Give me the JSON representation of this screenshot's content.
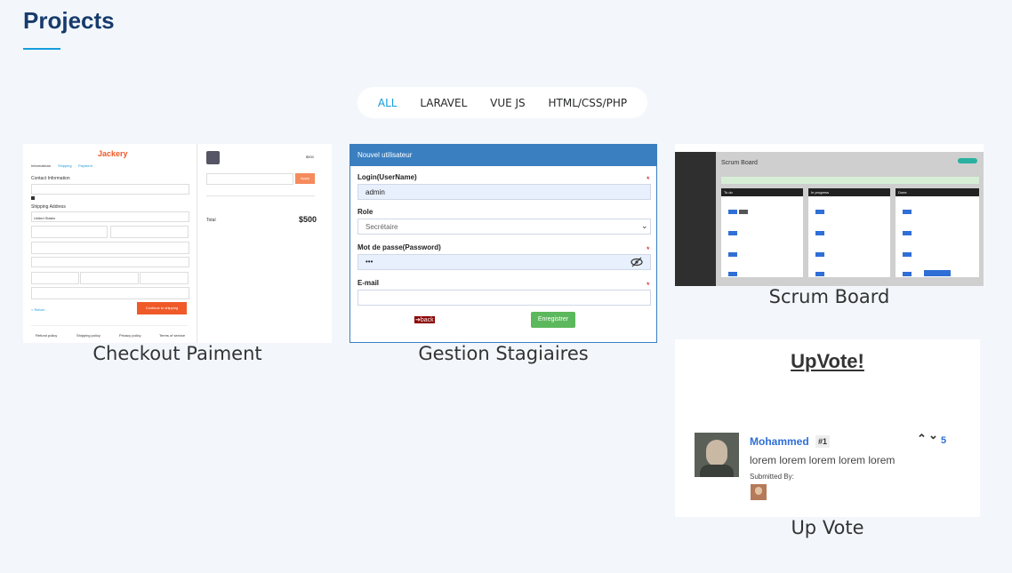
{
  "section": {
    "title": "Projects"
  },
  "filters": [
    {
      "label": "ALL",
      "active": true
    },
    {
      "label": "LARAVEL",
      "active": false
    },
    {
      "label": "VUE JS",
      "active": false
    },
    {
      "label": "HTML/CSS/PHP",
      "active": false
    }
  ],
  "projects": [
    {
      "caption": "Checkout Paiment",
      "preview": {
        "logo": "Jackery",
        "step_info": "Informations",
        "step_shipping": "Shipping",
        "step_payment": "Payment",
        "contact_heading": "Contact Information",
        "shipping_heading": "Shipping Address",
        "country": "United States",
        "return_link": "< Return",
        "continue_button": "Continue to shipping",
        "total_label": "Total",
        "total_value": "$500",
        "item_price": "$500",
        "apply_button": "Apply",
        "footer_links": [
          "Refund policy",
          "Shipping policy",
          "Privacy policy",
          "Terms of service"
        ]
      }
    },
    {
      "caption": "Gestion Stagiaires",
      "preview": {
        "header": "Nouvel utilisateur",
        "login_label": "Login(UserName)",
        "login_value": "admin",
        "role_label": "Role",
        "role_value": "Secrétaire",
        "password_label": "Mot de passe(Password)",
        "password_value": "•••",
        "email_label": "E-mail",
        "back_button": "➔back",
        "save_button": "Enregistrer",
        "required_mark": "*"
      }
    },
    {
      "caption": "Scrum Board",
      "preview": {
        "page_title": "Scrum Board",
        "columns": [
          "To do",
          "In progress",
          "Done"
        ]
      }
    },
    {
      "caption": "Up Vote",
      "preview": {
        "title": "UpVote!",
        "author": "Mohammed",
        "rank": "#1",
        "body": "lorem lorem lorem lorem lorem",
        "submitted_by": "Submitted By:",
        "votes": "5",
        "upvote_glyph": "⌃",
        "downvote_glyph": "⌄"
      }
    }
  ],
  "colors": {
    "accent": "#149ddd",
    "heading": "#173b6c",
    "jackery_orange": "#f05a28",
    "gestion_header": "#3a7fc0",
    "save_green": "#5cb85c",
    "back_red": "#8b0000",
    "upvote_blue": "#2f6fd6"
  }
}
